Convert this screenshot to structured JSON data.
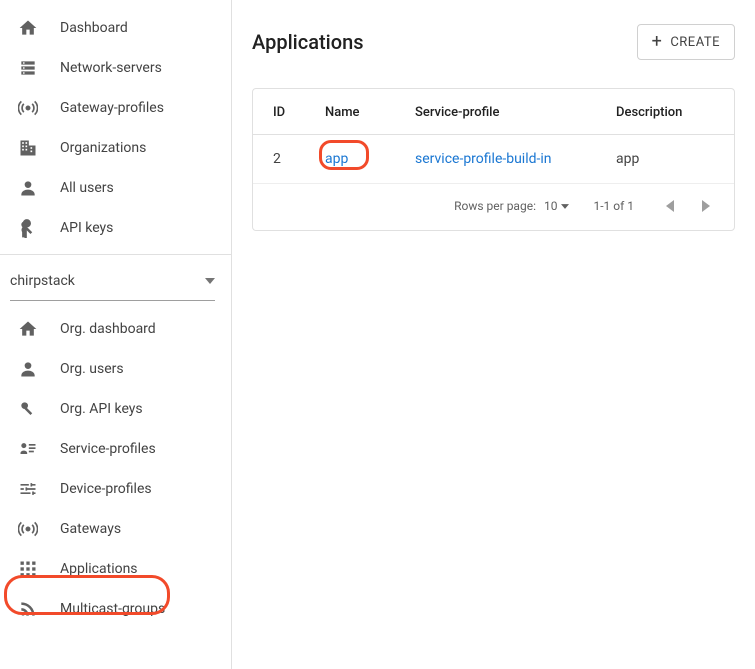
{
  "sidebar": {
    "global": [
      {
        "label": "Dashboard"
      },
      {
        "label": "Network-servers"
      },
      {
        "label": "Gateway-profiles"
      },
      {
        "label": "Organizations"
      },
      {
        "label": "All users"
      },
      {
        "label": "API keys"
      }
    ],
    "org_selected": "chirpstack",
    "org": [
      {
        "label": "Org. dashboard"
      },
      {
        "label": "Org. users"
      },
      {
        "label": "Org. API keys"
      },
      {
        "label": "Service-profiles"
      },
      {
        "label": "Device-profiles"
      },
      {
        "label": "Gateways"
      },
      {
        "label": "Applications"
      },
      {
        "label": "Multicast-groups"
      }
    ]
  },
  "page": {
    "title": "Applications",
    "create_label": "CREATE"
  },
  "table": {
    "headers": {
      "id": "ID",
      "name": "Name",
      "service_profile": "Service-profile",
      "description": "Description"
    },
    "rows": [
      {
        "id": "2",
        "name": "app",
        "service_profile": "service-profile-build-in",
        "description": "app"
      }
    ]
  },
  "pager": {
    "rows_per_page_label": "Rows per page:",
    "rows_per_page_value": "10",
    "range": "1-1 of 1"
  }
}
